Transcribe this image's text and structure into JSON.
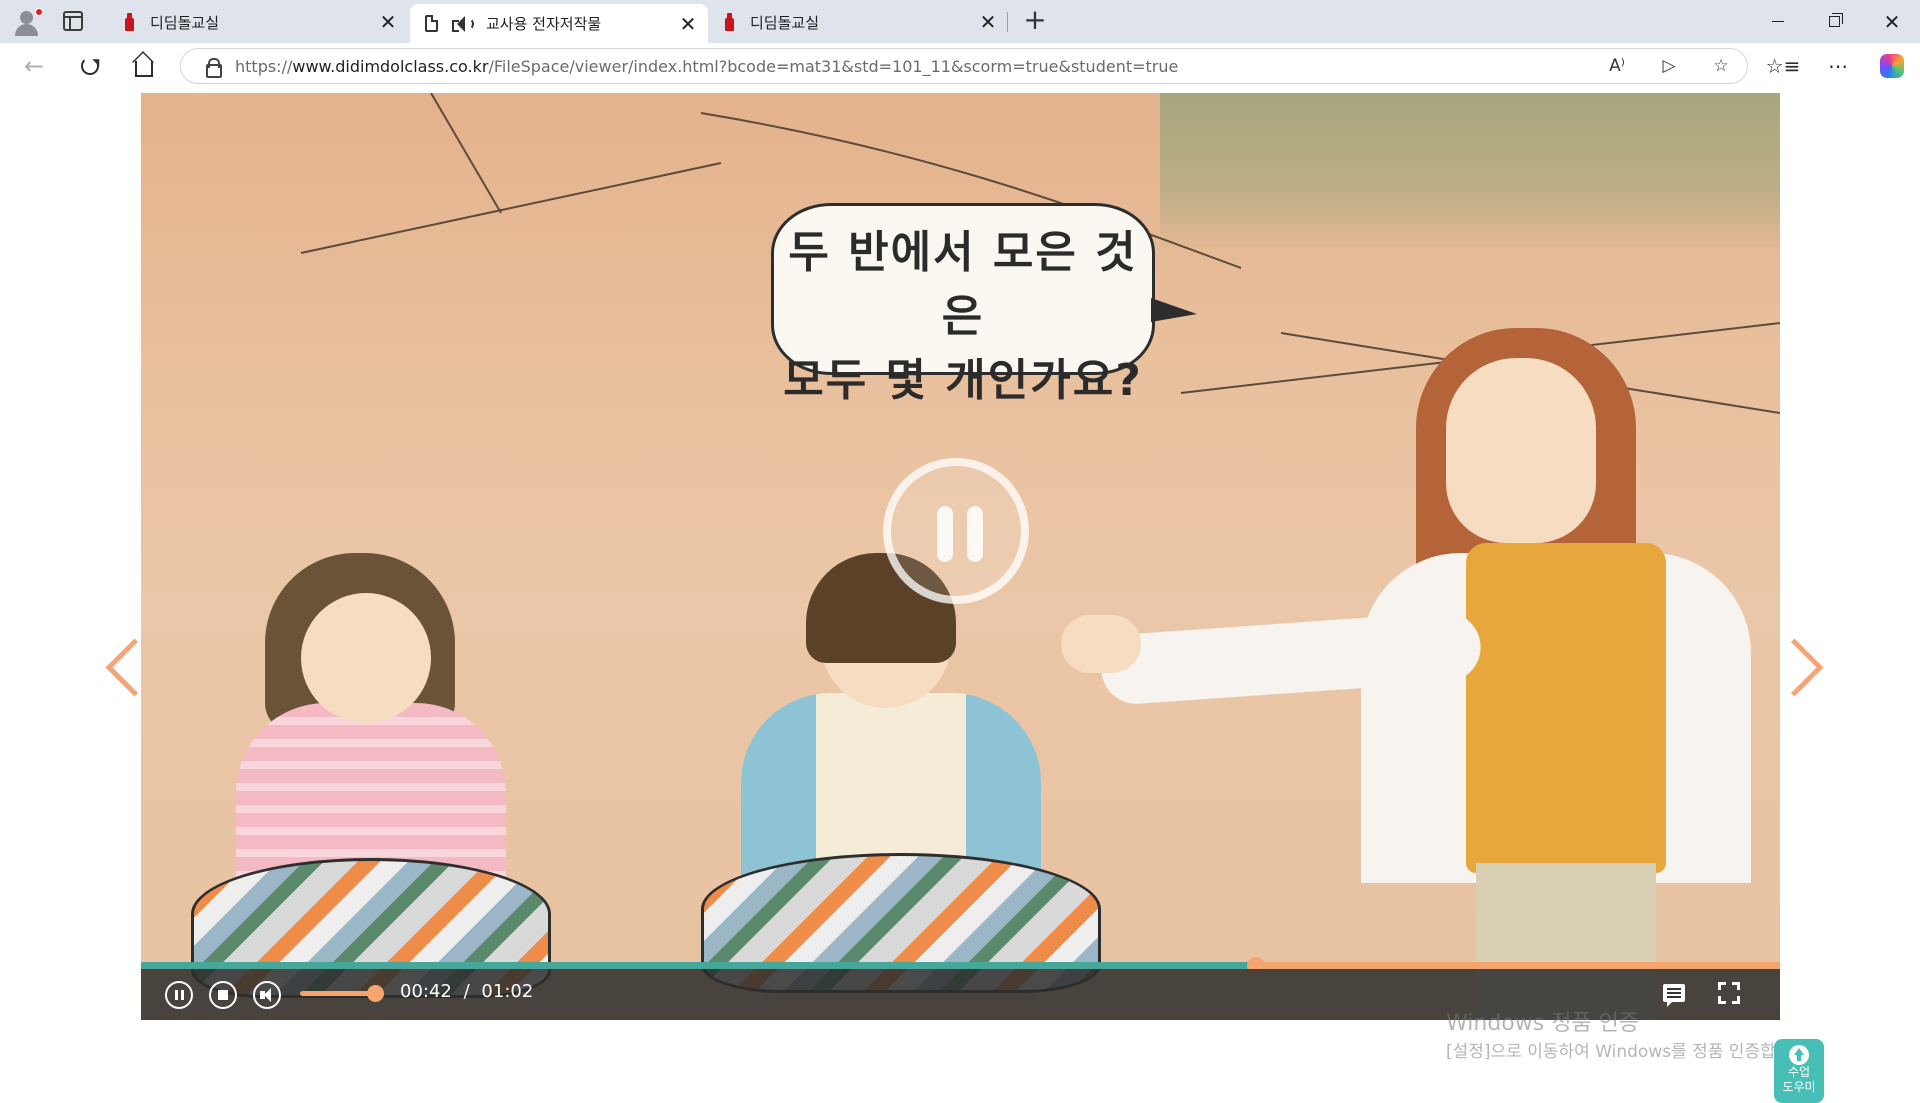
{
  "browser": {
    "tabs": [
      {
        "title": "디딤돌교실",
        "icon": "bottle-favicon",
        "active": false
      },
      {
        "title": "교사용 전자저작물",
        "icon": "document-favicon",
        "active": true,
        "audio": true
      },
      {
        "title": "디딤돌교실",
        "icon": "bottle-favicon",
        "active": false
      }
    ],
    "close_glyph": "✕",
    "new_tab_glyph": "+",
    "window_close_glyph": "✕",
    "url": {
      "scheme": "https://",
      "host": "www.didimdolclass.co.kr",
      "path": "/FileSpace/viewer/index.html?bcode=mat31&std=101_11&scorm=true&student=true"
    },
    "url_icons": [
      "read-aloud-icon",
      "media-icon",
      "favorite-star-icon"
    ],
    "toolbar_icons": [
      "favorites-icon",
      "more-icon",
      "copilot-icon"
    ]
  },
  "video": {
    "speech": {
      "line1": "두 반에서 모은 것은",
      "line2": "모두 몇 개인가요?"
    },
    "progress": 0.68,
    "volume": 0.85,
    "time": {
      "current": "00:42",
      "separator": "/",
      "total": "01:02"
    },
    "helper_label": {
      "line1": "수업",
      "line2": "도우미"
    }
  },
  "watermark": {
    "line1": "Windows 정품 인증",
    "line2": "[설정]으로 이동하여 Windows를 정품 인증합니다."
  },
  "colors": {
    "accent_teal": "#47a79a",
    "accent_orange": "#f4a56e",
    "helper_teal": "#48bfb6"
  }
}
